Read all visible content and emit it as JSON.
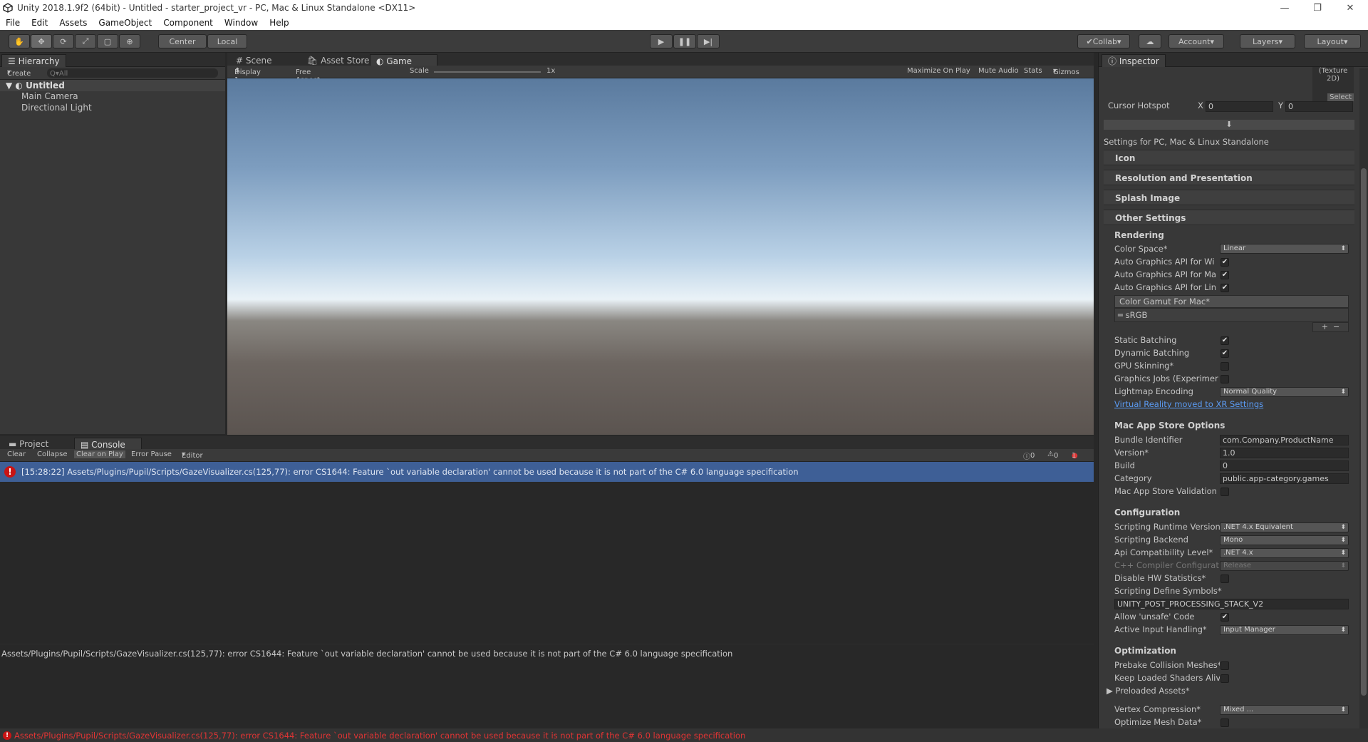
{
  "window": {
    "title": "Unity 2018.1.9f2 (64bit) - Untitled - starter_project_vr - PC, Mac & Linux Standalone <DX11>"
  },
  "menu": [
    "File",
    "Edit",
    "Assets",
    "GameObject",
    "Component",
    "Window",
    "Help"
  ],
  "toolbar": {
    "center": "Center",
    "local": "Local",
    "collab": "Collab",
    "account": "Account",
    "layers": "Layers",
    "layout": "Layout"
  },
  "hierarchy": {
    "tab": "Hierarchy",
    "create": "Create",
    "search_placeholder": "Q▾All",
    "scene": "Untitled",
    "items": [
      "Main Camera",
      "Directional Light"
    ]
  },
  "viewtabs": {
    "scene": "Scene",
    "asset_store": "Asset Store",
    "game": "Game"
  },
  "gamebar": {
    "display": "Display 1",
    "aspect": "Free Aspect",
    "scale_label": "Scale",
    "scale_value": "1x",
    "maximize": "Maximize On Play",
    "mute": "Mute Audio",
    "stats": "Stats",
    "gizmos": "Gizmos"
  },
  "bottomtabs": {
    "project": "Project",
    "console": "Console"
  },
  "consolebar": {
    "clear": "Clear",
    "collapse": "Collapse",
    "clear_on_play": "Clear on Play",
    "error_pause": "Error Pause",
    "editor": "Editor",
    "info_count": "0",
    "warn_count": "0",
    "error_count": "1"
  },
  "console": {
    "entry": "[15:28:22] Assets/Plugins/Pupil/Scripts/GazeVisualizer.cs(125,77): error CS1644: Feature `out variable declaration' cannot be used because it is not part of the C# 6.0 language specification",
    "detail": "Assets/Plugins/Pupil/Scripts/GazeVisualizer.cs(125,77): error CS1644: Feature `out variable declaration' cannot be used because it is not part of the C# 6.0 language specification"
  },
  "status": "Assets/Plugins/Pupil/Scripts/GazeVisualizer.cs(125,77): error CS1644: Feature `out variable declaration' cannot be used because it is not part of the C# 6.0 language specification",
  "inspector": {
    "tab": "Inspector",
    "texture_label": "(Texture 2D)",
    "select": "Select",
    "cursor_hotspot": "Cursor Hotspot",
    "x_label": "X",
    "x_value": "0",
    "y_label": "Y",
    "y_value": "0",
    "settings_for": "Settings for PC, Mac & Linux Standalone",
    "sections": [
      "Icon",
      "Resolution and Presentation",
      "Splash Image",
      "Other Settings"
    ],
    "rendering": "Rendering",
    "color_space": "Color Space*",
    "color_space_value": "Linear",
    "auto_api_win": "Auto Graphics API  for Wi",
    "auto_api_mac": "Auto Graphics API  for Ma",
    "auto_api_linux": "Auto Graphics API  for Lin",
    "gamut_header": "Color Gamut For Mac*",
    "gamut_item": "sRGB",
    "static_batching": "Static Batching",
    "dynamic_batching": "Dynamic Batching",
    "gpu_skinning": "GPU Skinning*",
    "graphics_jobs": "Graphics Jobs (Experimer",
    "lightmap_encoding": "Lightmap Encoding",
    "lightmap_value": "Normal Quality",
    "vr_link": "Virtual Reality moved to XR Settings",
    "mac_store": "Mac App Store Options",
    "bundle_id": "Bundle Identifier",
    "bundle_id_value": "com.Company.ProductName",
    "version": "Version*",
    "version_value": "1.0",
    "build": "Build",
    "build_value": "0",
    "category": "Category",
    "category_value": "public.app-category.games",
    "mac_validation": "Mac App Store Validation",
    "configuration": "Configuration",
    "runtime": "Scripting Runtime Version",
    "runtime_value": ".NET 4.x Equivalent",
    "backend": "Scripting Backend",
    "backend_value": "Mono",
    "api_level": "Api Compatibility Level*",
    "api_level_value": ".NET 4.x",
    "cpp_config": "C++ Compiler Configurat",
    "cpp_config_value": "Release",
    "disable_hw": "Disable HW Statistics*",
    "define_symbols": "Scripting Define Symbols*",
    "define_symbols_value": "UNITY_POST_PROCESSING_STACK_V2",
    "unsafe": "Allow 'unsafe' Code",
    "input_handling": "Active Input Handling*",
    "input_handling_value": "Input Manager",
    "optimization": "Optimization",
    "prebake": "Prebake Collision Meshes*",
    "keep_shaders": "Keep Loaded Shaders Aliv",
    "preloaded": "Preloaded Assets*",
    "vertex_compression": "Vertex Compression*",
    "vertex_compression_value": "Mixed ...",
    "optimize_mesh": "Optimize Mesh Data*"
  },
  "colors": {
    "selection": "#3e5f96",
    "error": "#c91414",
    "link": "#5b9cf5"
  }
}
